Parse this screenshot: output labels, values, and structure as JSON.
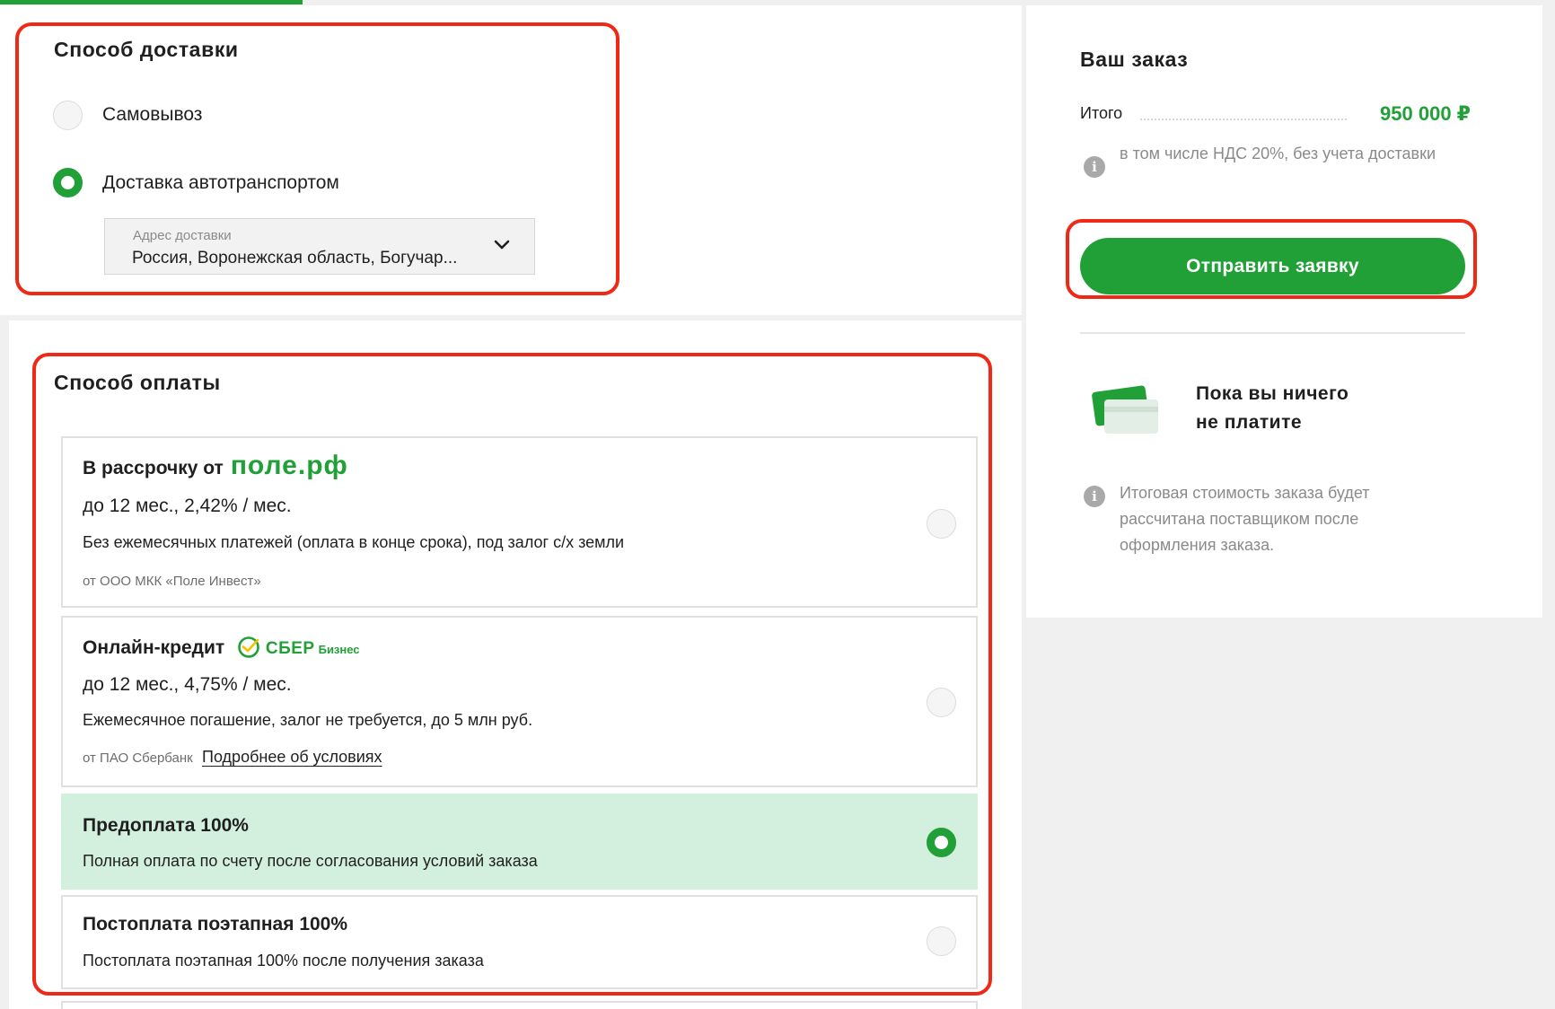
{
  "delivery": {
    "title": "Способ доставки",
    "options": [
      {
        "label": "Самовывоз",
        "selected": false
      },
      {
        "label": "Доставка автотранспортом",
        "selected": true
      }
    ],
    "address": {
      "label": "Адрес доставки",
      "value": "Россия, Воронежская область, Богучар..."
    }
  },
  "payment": {
    "title": "Способ оплаты",
    "options": [
      {
        "title": "В рассрочку от",
        "brand": "поле.рф",
        "rate": "до 12 мес., 2,42% / мес.",
        "description": "Без ежемесячных платежей (оплата в конце срока), под залог с/х земли",
        "issuer": "от ООО МКК «Поле Инвест»",
        "selected": false
      },
      {
        "title": "Онлайн-кредит",
        "brand": "СБЕР",
        "brand_sub": "Бизнес",
        "rate": "до 12 мес., 4,75% / мес.",
        "description": "Ежемесячное погашение, залог не требуется, до 5 млн руб.",
        "issuer": "от ПАО Сбербанк",
        "link": "Подробнее об условиях",
        "selected": false
      },
      {
        "title": "Предоплата 100%",
        "description": "Полная оплата по счету после согласования условий заказа",
        "selected": true
      },
      {
        "title": "Постоплата поэтапная 100%",
        "description": "Постоплата поэтапная 100% после получения заказа",
        "selected": false
      }
    ]
  },
  "order": {
    "title": "Ваш заказ",
    "total_label": "Итого",
    "total_value": "950 000 ₽",
    "vat_note": "в том числе НДС 20%, без учета доставки",
    "submit_label": "Отправить заявку",
    "notice": "Пока вы ничего не платите",
    "final_note": "Итоговая стоимость заказа будет рассчитана поставщиком после оформления заказа."
  },
  "colors": {
    "accent": "#21a038",
    "selected_bg": "#d3f0df",
    "highlight_frame": "#ee2a17"
  }
}
